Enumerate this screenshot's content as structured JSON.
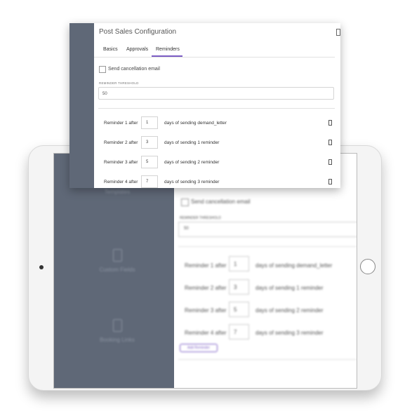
{
  "window": {
    "title": "Post Sales Configuration"
  },
  "tabs": [
    {
      "label": "Basics",
      "active": false
    },
    {
      "label": "Approvals",
      "active": false
    },
    {
      "label": "Reminders",
      "active": true
    }
  ],
  "cancellation": {
    "label": "Send cancellation email",
    "checked": false
  },
  "threshold": {
    "label": "REMINDER THRESHOLD",
    "value": "50"
  },
  "reminders": [
    {
      "before": "Reminder 1 after",
      "days": "1",
      "after": "days of sending demand_letter"
    },
    {
      "before": "Reminder 2 after",
      "days": "3",
      "after": "days of sending 1 reminder"
    },
    {
      "before": "Reminder 3 after",
      "days": "5",
      "after": "days of sending 2 reminder"
    },
    {
      "before": "Reminder 4 after",
      "days": "7",
      "after": "days of sending 3 reminder"
    }
  ],
  "add_reminder": {
    "label": "Add Reminder"
  },
  "tablet_sidebar": [
    {
      "label": "Templates"
    },
    {
      "label": "Custom Fields"
    },
    {
      "label": "Booking Links"
    }
  ],
  "colors": {
    "accent": "#7b5cc4",
    "sidebar": "#5f6877"
  }
}
